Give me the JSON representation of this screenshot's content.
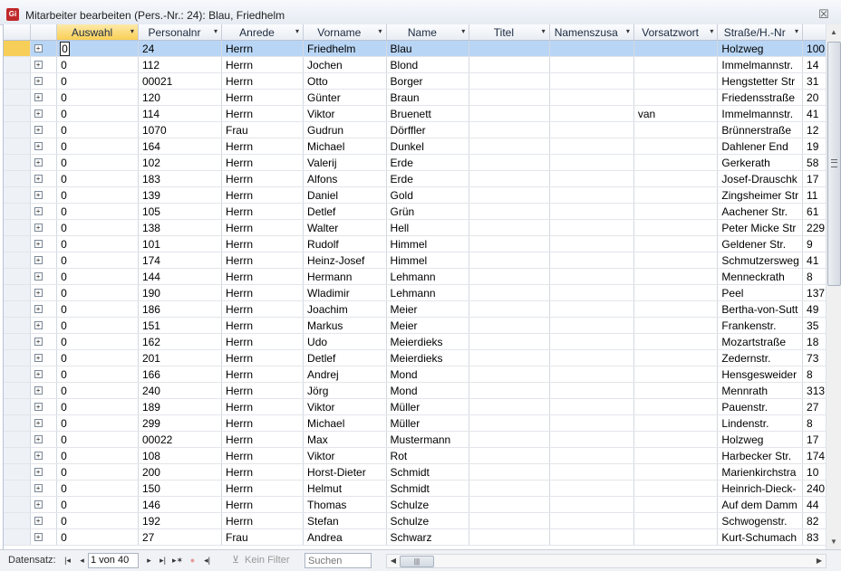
{
  "window": {
    "title": "Mitarbeiter bearbeiten (Pers.-Nr.: 24): Blau, Friedhelm",
    "app_icon_text": "Gi"
  },
  "columns": [
    "Auswahl",
    "Personalnr",
    "Anrede",
    "Vorname",
    "Name",
    "Titel",
    "Namenszusa",
    "Vorsatzwort",
    "Straße/H.-Nr",
    ""
  ],
  "rows": [
    {
      "auswahl": "0",
      "personalnr": "24",
      "anrede": "Herrn",
      "vorname": "Friedhelm",
      "name": "Blau",
      "titel": "",
      "namenszusatz": "",
      "vorsatzwort": "",
      "strasse": "Holzweg",
      "hnr": "100"
    },
    {
      "auswahl": "0",
      "personalnr": "112",
      "anrede": "Herrn",
      "vorname": "Jochen",
      "name": "Blond",
      "titel": "",
      "namenszusatz": "",
      "vorsatzwort": "",
      "strasse": "Immelmannstr.",
      "hnr": "14"
    },
    {
      "auswahl": "0",
      "personalnr": "00021",
      "anrede": "Herrn",
      "vorname": "Otto",
      "name": "Borger",
      "titel": "",
      "namenszusatz": "",
      "vorsatzwort": "",
      "strasse": "Hengstetter Str",
      "hnr": "31"
    },
    {
      "auswahl": "0",
      "personalnr": "120",
      "anrede": "Herrn",
      "vorname": "Günter",
      "name": "Braun",
      "titel": "",
      "namenszusatz": "",
      "vorsatzwort": "",
      "strasse": "Friedensstraße",
      "hnr": "20"
    },
    {
      "auswahl": "0",
      "personalnr": "114",
      "anrede": "Herrn",
      "vorname": "Viktor",
      "name": "Bruenett",
      "titel": "",
      "namenszusatz": "",
      "vorsatzwort": "van",
      "strasse": "Immelmannstr.",
      "hnr": "41"
    },
    {
      "auswahl": "0",
      "personalnr": "1070",
      "anrede": "Frau",
      "vorname": "Gudrun",
      "name": "Dörffler",
      "titel": "",
      "namenszusatz": "",
      "vorsatzwort": "",
      "strasse": "Brünnerstraße",
      "hnr": "12"
    },
    {
      "auswahl": "0",
      "personalnr": "164",
      "anrede": "Herrn",
      "vorname": "Michael",
      "name": "Dunkel",
      "titel": "",
      "namenszusatz": "",
      "vorsatzwort": "",
      "strasse": "Dahlener End",
      "hnr": "19"
    },
    {
      "auswahl": "0",
      "personalnr": "102",
      "anrede": "Herrn",
      "vorname": "Valerij",
      "name": "Erde",
      "titel": "",
      "namenszusatz": "",
      "vorsatzwort": "",
      "strasse": "Gerkerath",
      "hnr": "58"
    },
    {
      "auswahl": "0",
      "personalnr": "183",
      "anrede": "Herrn",
      "vorname": "Alfons",
      "name": "Erde",
      "titel": "",
      "namenszusatz": "",
      "vorsatzwort": "",
      "strasse": "Josef-Drauschk",
      "hnr": "17"
    },
    {
      "auswahl": "0",
      "personalnr": "139",
      "anrede": "Herrn",
      "vorname": "Daniel",
      "name": "Gold",
      "titel": "",
      "namenszusatz": "",
      "vorsatzwort": "",
      "strasse": "Zingsheimer Str",
      "hnr": "11"
    },
    {
      "auswahl": "0",
      "personalnr": "105",
      "anrede": "Herrn",
      "vorname": "Detlef",
      "name": "Grün",
      "titel": "",
      "namenszusatz": "",
      "vorsatzwort": "",
      "strasse": "Aachener Str.",
      "hnr": "61"
    },
    {
      "auswahl": "0",
      "personalnr": "138",
      "anrede": "Herrn",
      "vorname": "Walter",
      "name": "Hell",
      "titel": "",
      "namenszusatz": "",
      "vorsatzwort": "",
      "strasse": "Peter Micke Str",
      "hnr": "229"
    },
    {
      "auswahl": "0",
      "personalnr": "101",
      "anrede": "Herrn",
      "vorname": "Rudolf",
      "name": "Himmel",
      "titel": "",
      "namenszusatz": "",
      "vorsatzwort": "",
      "strasse": "Geldener Str.",
      "hnr": "9"
    },
    {
      "auswahl": "0",
      "personalnr": "174",
      "anrede": "Herrn",
      "vorname": "Heinz-Josef",
      "name": "Himmel",
      "titel": "",
      "namenszusatz": "",
      "vorsatzwort": "",
      "strasse": "Schmutzersweg",
      "hnr": "41"
    },
    {
      "auswahl": "0",
      "personalnr": "144",
      "anrede": "Herrn",
      "vorname": "Hermann",
      "name": "Lehmann",
      "titel": "",
      "namenszusatz": "",
      "vorsatzwort": "",
      "strasse": "Menneckrath",
      "hnr": "8"
    },
    {
      "auswahl": "0",
      "personalnr": "190",
      "anrede": "Herrn",
      "vorname": "Wladimir",
      "name": "Lehmann",
      "titel": "",
      "namenszusatz": "",
      "vorsatzwort": "",
      "strasse": "Peel",
      "hnr": "137"
    },
    {
      "auswahl": "0",
      "personalnr": "186",
      "anrede": "Herrn",
      "vorname": "Joachim",
      "name": "Meier",
      "titel": "",
      "namenszusatz": "",
      "vorsatzwort": "",
      "strasse": "Bertha-von-Sutt",
      "hnr": "49"
    },
    {
      "auswahl": "0",
      "personalnr": "151",
      "anrede": "Herrn",
      "vorname": "Markus",
      "name": "Meier",
      "titel": "",
      "namenszusatz": "",
      "vorsatzwort": "",
      "strasse": "Frankenstr.",
      "hnr": "35"
    },
    {
      "auswahl": "0",
      "personalnr": "162",
      "anrede": "Herrn",
      "vorname": "Udo",
      "name": "Meierdieks",
      "titel": "",
      "namenszusatz": "",
      "vorsatzwort": "",
      "strasse": "Mozartstraße",
      "hnr": "18"
    },
    {
      "auswahl": "0",
      "personalnr": "201",
      "anrede": "Herrn",
      "vorname": "Detlef",
      "name": "Meierdieks",
      "titel": "",
      "namenszusatz": "",
      "vorsatzwort": "",
      "strasse": "Zedernstr.",
      "hnr": "73"
    },
    {
      "auswahl": "0",
      "personalnr": "166",
      "anrede": "Herrn",
      "vorname": "Andrej",
      "name": "Mond",
      "titel": "",
      "namenszusatz": "",
      "vorsatzwort": "",
      "strasse": "Hensgesweider",
      "hnr": "8"
    },
    {
      "auswahl": "0",
      "personalnr": "240",
      "anrede": "Herrn",
      "vorname": "Jörg",
      "name": "Mond",
      "titel": "",
      "namenszusatz": "",
      "vorsatzwort": "",
      "strasse": "Mennrath",
      "hnr": "313"
    },
    {
      "auswahl": "0",
      "personalnr": "189",
      "anrede": "Herrn",
      "vorname": "Viktor",
      "name": "Müller",
      "titel": "",
      "namenszusatz": "",
      "vorsatzwort": "",
      "strasse": "Pauenstr.",
      "hnr": "27"
    },
    {
      "auswahl": "0",
      "personalnr": "299",
      "anrede": "Herrn",
      "vorname": "Michael",
      "name": "Müller",
      "titel": "",
      "namenszusatz": "",
      "vorsatzwort": "",
      "strasse": "Lindenstr.",
      "hnr": "8"
    },
    {
      "auswahl": "0",
      "personalnr": "00022",
      "anrede": "Herrn",
      "vorname": "Max",
      "name": "Mustermann",
      "titel": "",
      "namenszusatz": "",
      "vorsatzwort": "",
      "strasse": "Holzweg",
      "hnr": "17"
    },
    {
      "auswahl": "0",
      "personalnr": "108",
      "anrede": "Herrn",
      "vorname": "Viktor",
      "name": "Rot",
      "titel": "",
      "namenszusatz": "",
      "vorsatzwort": "",
      "strasse": "Harbecker Str.",
      "hnr": "174"
    },
    {
      "auswahl": "0",
      "personalnr": "200",
      "anrede": "Herrn",
      "vorname": "Horst-Dieter",
      "name": "Schmidt",
      "titel": "",
      "namenszusatz": "",
      "vorsatzwort": "",
      "strasse": "Marienkirchstra",
      "hnr": "10"
    },
    {
      "auswahl": "0",
      "personalnr": "150",
      "anrede": "Herrn",
      "vorname": "Helmut",
      "name": "Schmidt",
      "titel": "",
      "namenszusatz": "",
      "vorsatzwort": "",
      "strasse": "Heinrich-Dieck-",
      "hnr": "240"
    },
    {
      "auswahl": "0",
      "personalnr": "146",
      "anrede": "Herrn",
      "vorname": "Thomas",
      "name": "Schulze",
      "titel": "",
      "namenszusatz": "",
      "vorsatzwort": "",
      "strasse": "Auf dem Damm",
      "hnr": "44"
    },
    {
      "auswahl": "0",
      "personalnr": "192",
      "anrede": "Herrn",
      "vorname": "Stefan",
      "name": "Schulze",
      "titel": "",
      "namenszusatz": "",
      "vorsatzwort": "",
      "strasse": "Schwogenstr.",
      "hnr": "82"
    },
    {
      "auswahl": "0",
      "personalnr": "27",
      "anrede": "Frau",
      "vorname": "Andrea",
      "name": "Schwarz",
      "titel": "",
      "namenszusatz": "",
      "vorsatzwort": "",
      "strasse": "Kurt-Schumach",
      "hnr": "83"
    }
  ],
  "statusbar": {
    "label": "Datensatz:",
    "record": "1 von 40",
    "filter_label": "Kein Filter",
    "search_placeholder": "Suchen"
  },
  "colors": {
    "selected_row": "#b8d5f5",
    "active_header": "#f9cf55",
    "app_icon": "#c0282a"
  }
}
